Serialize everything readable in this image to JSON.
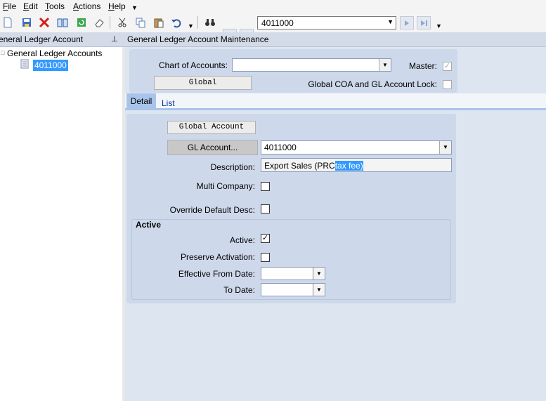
{
  "menu": [
    {
      "accel": "F",
      "rest": "ile"
    },
    {
      "accel": "E",
      "rest": "dit"
    },
    {
      "accel": "T",
      "rest": "ools"
    },
    {
      "accel": "A",
      "rest": "ctions"
    },
    {
      "accel": "H",
      "rest": "elp"
    }
  ],
  "toolbar": {
    "record_value": "4011000",
    "icons": [
      "new-icon",
      "save-icon",
      "delete-icon",
      "open-book-icon",
      "refresh-icon",
      "eraser-icon",
      "cut-icon",
      "copy-icon",
      "paste-icon",
      "undo-icon",
      "find-binoculars-icon",
      "first-record-icon",
      "previous-record-icon",
      "next-record-icon",
      "last-record-icon"
    ]
  },
  "left_pane": {
    "title": "eneral Ledger Account",
    "pin_glyph": "⊥",
    "tree_root": "General Ledger Accounts",
    "tree_node": "4011000"
  },
  "right_pane": {
    "title": "General Ledger Account Maintenance",
    "chart_of_accounts_label": "Chart of Accounts:",
    "chart_of_accounts_value": "",
    "global_button": "Global",
    "master_label": "Master:",
    "master_checked": true,
    "global_lock_label": "Global COA and GL Account Lock:",
    "global_lock_checked": false,
    "tabs": [
      "Detail",
      "List"
    ],
    "active_tab": "Detail"
  },
  "detail": {
    "global_account_button": "Global Account",
    "gl_account_button": "GL Account...",
    "gl_account_value": "4011000",
    "description_label": "Description:",
    "description_prefix": "Export Sales (PRC",
    "description_selected": "tax fee)",
    "multi_company_label": "Multi Company:",
    "multi_company_checked": false,
    "override_label": "Override Default Desc:",
    "override_checked": false
  },
  "active_group": {
    "title": "Active",
    "active_label": "Active:",
    "active_checked": true,
    "preserve_label": "Preserve Activation:",
    "preserve_checked": false,
    "from_label": "Effective From Date:",
    "from_value": "",
    "to_label": "To Date:",
    "to_value": ""
  },
  "colors": {
    "selection": "#3399ff",
    "panel": "#cdd8ea",
    "tab_active": "#a9c4ea"
  }
}
